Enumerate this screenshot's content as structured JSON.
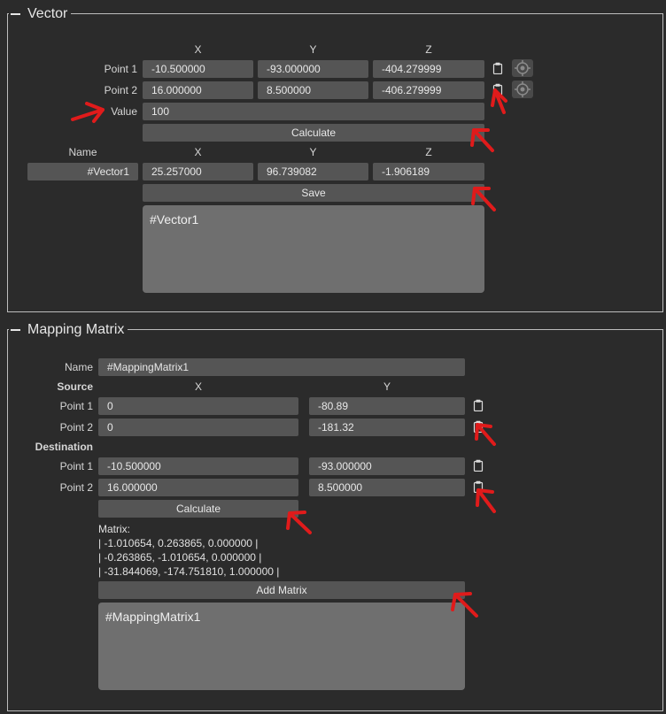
{
  "vector": {
    "title": "Vector",
    "col_x": "X",
    "col_y": "Y",
    "col_z": "Z",
    "point1_label": "Point 1",
    "point1": [
      "-10.500000",
      "-93.000000",
      "-404.279999"
    ],
    "point2_label": "Point 2",
    "point2": [
      "16.000000",
      "8.500000",
      "-406.279999"
    ],
    "value_label": "Value",
    "value": "100",
    "calculate_label": "Calculate",
    "name_label": "Name",
    "result_name": "#Vector1",
    "result": [
      "25.257000",
      "96.739082",
      "-1.906189"
    ],
    "save_label": "Save",
    "notes": "#Vector1"
  },
  "mapping": {
    "title": "Mapping Matrix",
    "name_label": "Name",
    "name_value": "#MappingMatrix1",
    "source_label": "Source",
    "col_x": "X",
    "col_y": "Y",
    "src_point1_label": "Point 1",
    "src_point1": [
      "0",
      "-80.89"
    ],
    "src_point2_label": "Point 2",
    "src_point2": [
      "0",
      "-181.32"
    ],
    "destination_label": "Destination",
    "dst_point1_label": "Point 1",
    "dst_point1": [
      "-10.500000",
      "-93.000000"
    ],
    "dst_point2_label": "Point 2",
    "dst_point2": [
      "16.000000",
      "8.500000"
    ],
    "calculate_label": "Calculate",
    "matrix_label": "Matrix:",
    "matrix_rows": [
      "| -1.010654, 0.263865, 0.000000 |",
      "| -0.263865, -1.010654, 0.000000 |",
      "| -31.844069, -174.751810, 1.000000 |"
    ],
    "add_matrix_label": "Add Matrix",
    "notes": "#MappingMatrix1"
  },
  "colors": {
    "background": "#2b2b2b",
    "field": "#555555",
    "textarea": "#6f6f6f",
    "annotation_arrow": "#e01b1b"
  }
}
